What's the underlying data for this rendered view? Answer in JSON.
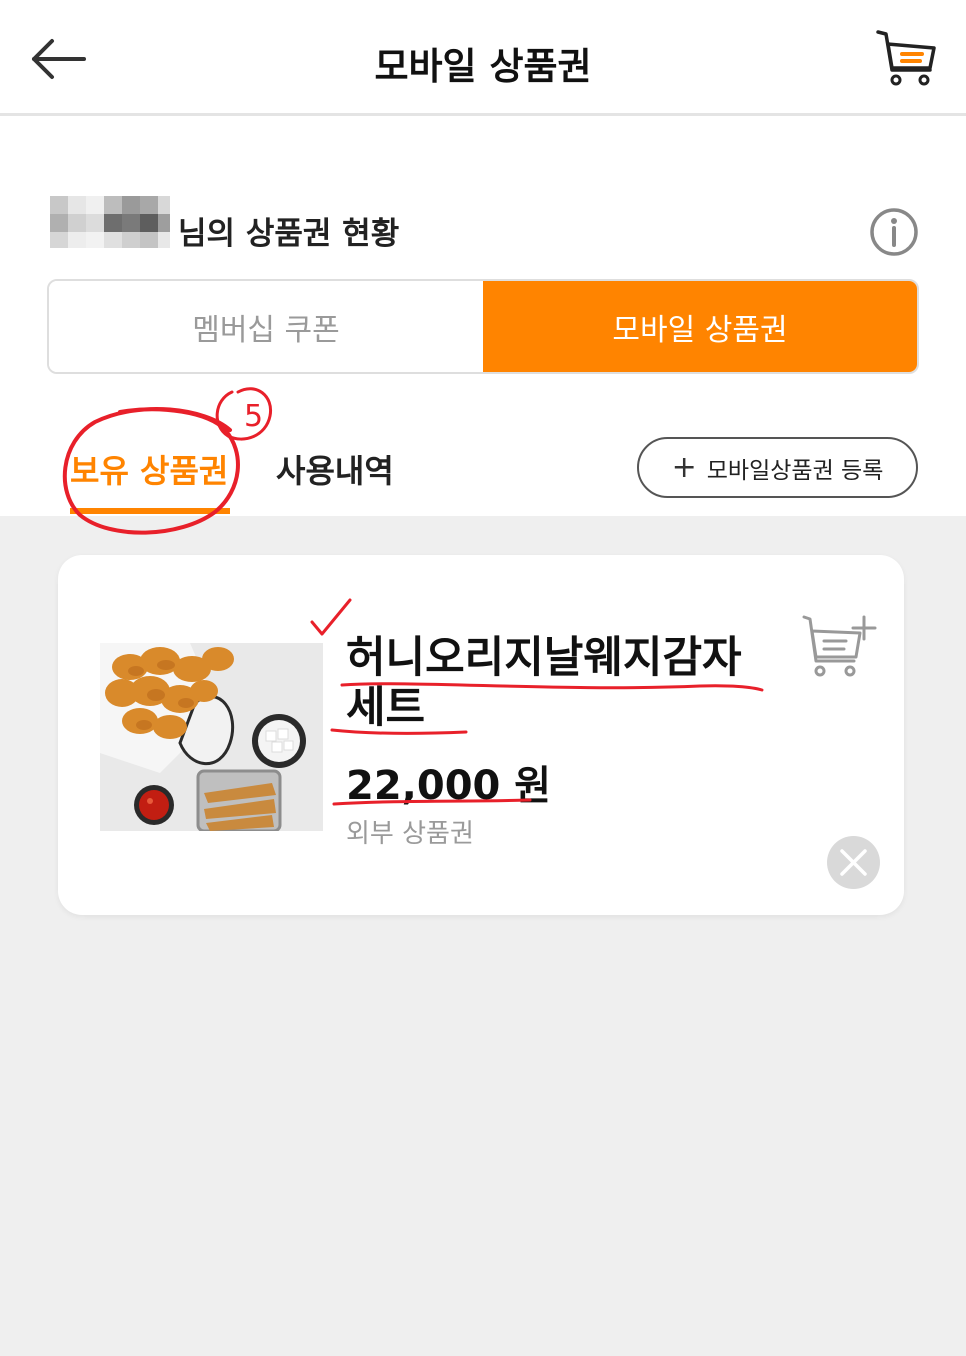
{
  "header": {
    "title": "모바일 상품권",
    "back_icon": "arrow-left-icon",
    "cart_icon": "cart-icon"
  },
  "status": {
    "label": "님의 상품권 현황",
    "info_icon": "info-icon"
  },
  "segments": {
    "membership": "멤버십 쿠폰",
    "mobile": "모바일 상품권",
    "active": "mobile"
  },
  "subtabs": {
    "owned": "보유 상품권",
    "history": "사용내역"
  },
  "register_button": {
    "icon": "+",
    "label": "모바일상품권 등록"
  },
  "voucher": {
    "name": "허니오리지날웨지감자 세트",
    "price": "22,000 원",
    "type": "외부 상품권"
  },
  "annotations": {
    "circle_number": "5"
  },
  "colors": {
    "accent": "#ff8400",
    "annotation": "#e8202a",
    "background": "#efefef"
  }
}
